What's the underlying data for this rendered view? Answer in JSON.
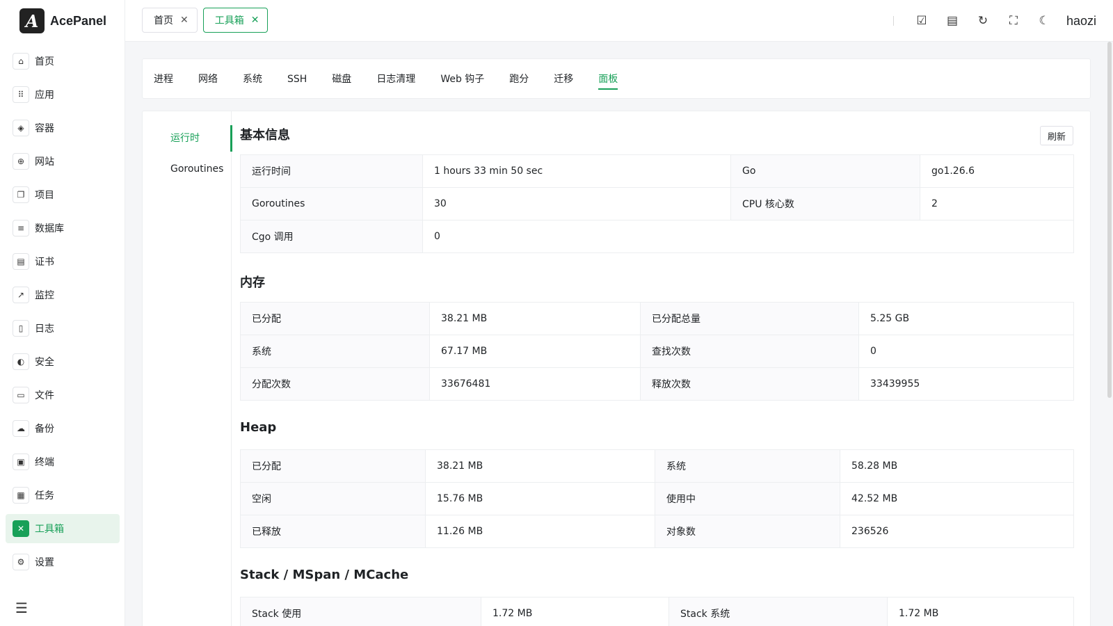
{
  "app": {
    "name": "AcePanel",
    "logo_letter": "A"
  },
  "sidebar": {
    "items": [
      {
        "label": "首页",
        "icon": "⌂"
      },
      {
        "label": "应用",
        "icon": "⠿"
      },
      {
        "label": "容器",
        "icon": "◈"
      },
      {
        "label": "网站",
        "icon": "⊕"
      },
      {
        "label": "项目",
        "icon": "❐"
      },
      {
        "label": "数据库",
        "icon": "≡"
      },
      {
        "label": "证书",
        "icon": "▤"
      },
      {
        "label": "监控",
        "icon": "↗"
      },
      {
        "label": "日志",
        "icon": "▯"
      },
      {
        "label": "安全",
        "icon": "◐"
      },
      {
        "label": "文件",
        "icon": "▭"
      },
      {
        "label": "备份",
        "icon": "☁"
      },
      {
        "label": "终端",
        "icon": "▣"
      },
      {
        "label": "任务",
        "icon": "▦"
      },
      {
        "label": "工具箱",
        "icon": "✕"
      },
      {
        "label": "设置",
        "icon": "⚙"
      }
    ]
  },
  "topbar": {
    "tabs": [
      {
        "label": "首页"
      },
      {
        "label": "工具箱"
      }
    ],
    "username": "haozi"
  },
  "tool_tabs": [
    "进程",
    "网络",
    "系统",
    "SSH",
    "磁盘",
    "日志清理",
    "Web 钩子",
    "跑分",
    "迁移",
    "面板"
  ],
  "subnav": [
    "运行时",
    "Goroutines"
  ],
  "refresh_label": "刷新",
  "sections": {
    "basic": {
      "title": "基本信息",
      "rows": [
        [
          "运行时间",
          "1 hours 33 min 50 sec",
          "Go",
          "go1.26.6"
        ],
        [
          "Goroutines",
          "30",
          "CPU 核心数",
          "2"
        ],
        [
          "Cgo 调用",
          "0"
        ]
      ]
    },
    "memory": {
      "title": "内存",
      "rows": [
        [
          "已分配",
          "38.21 MB",
          "已分配总量",
          "5.25 GB"
        ],
        [
          "系统",
          "67.17 MB",
          "查找次数",
          "0"
        ],
        [
          "分配次数",
          "33676481",
          "释放次数",
          "33439955"
        ]
      ]
    },
    "heap": {
      "title": "Heap",
      "rows": [
        [
          "已分配",
          "38.21 MB",
          "系统",
          "58.28 MB"
        ],
        [
          "空闲",
          "15.76 MB",
          "使用中",
          "42.52 MB"
        ],
        [
          "已释放",
          "11.26 MB",
          "对象数",
          "236526"
        ]
      ]
    },
    "stack": {
      "title": "Stack / MSpan / MCache",
      "rows": [
        [
          "Stack 使用",
          "1.72 MB",
          "Stack 系统",
          "1.72 MB"
        ]
      ]
    }
  }
}
